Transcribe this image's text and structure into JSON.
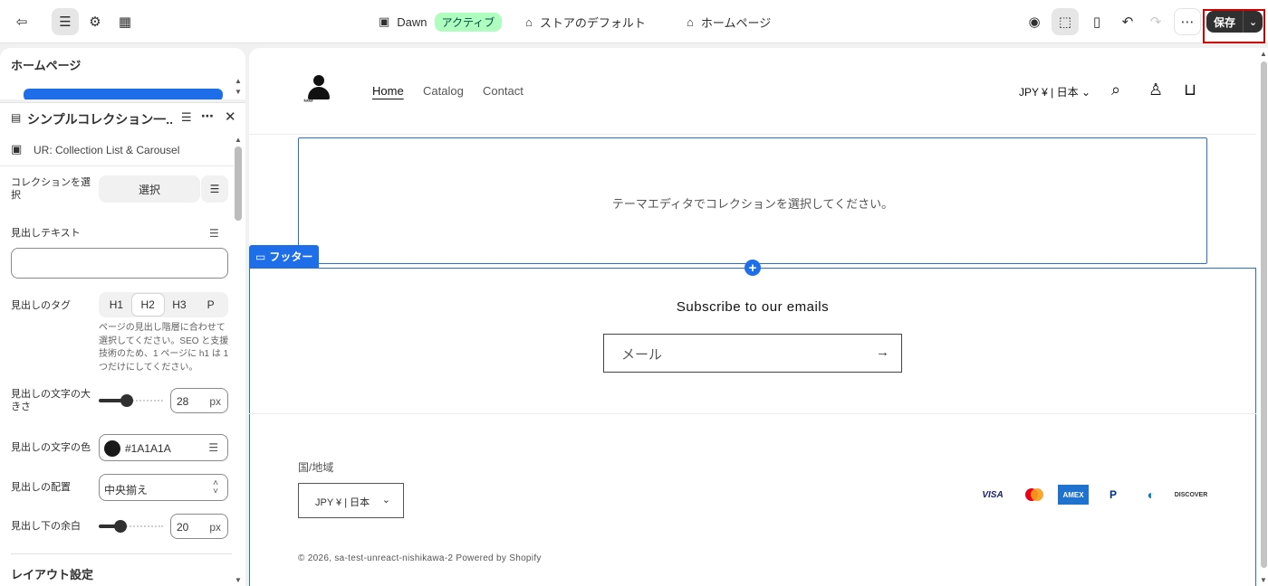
{
  "topbar": {
    "theme_name": "Dawn",
    "theme_status": "アクティブ",
    "store_default": "ストアのデフォルト",
    "page_template": "ホームページ",
    "save_label": "保存"
  },
  "sidebar": {
    "page_title": "ホームページ",
    "section_title": "シンプルコレクション一...",
    "app_block": "UR: Collection List & Carousel",
    "fields": {
      "collection_label": "コレクションを選択",
      "select_button": "選択",
      "heading_text_label": "見出しテキスト",
      "heading_text_value": "",
      "heading_tag_label": "見出しのタグ",
      "heading_tags": [
        "H1",
        "H2",
        "H3",
        "P"
      ],
      "heading_tag_selected": "H2",
      "heading_tag_help": "ページの見出し階層に合わせて選択してください。SEO と支援技術のため、1 ページに h1 は 1 つだけにしてください。",
      "font_size_label": "見出しの文字の大きさ",
      "font_size_value": "28",
      "font_size_unit": "px",
      "font_size_fraction": 0.42,
      "color_label": "見出しの文字の色",
      "color_value": "#1A1A1A",
      "align_label": "見出しの配置",
      "align_value": "中央揃え",
      "margin_label": "見出し下の余白",
      "margin_value": "20",
      "margin_unit": "px",
      "margin_fraction": 0.33
    },
    "next_section": "レイアウト設定"
  },
  "preview": {
    "logo_stars": "****",
    "nav": [
      "Home",
      "Catalog",
      "Contact"
    ],
    "currency": "JPY ¥ | 日本",
    "collection_placeholder": "テーマエディタでコレクションを選択してください。",
    "footer_tag": "フッター",
    "subscribe_title": "Subscribe to our emails",
    "email_placeholder": "メール",
    "country_label": "国/地域",
    "country_value": "JPY ¥ | 日本",
    "payments": [
      "VISA",
      "Mastercard",
      "AMEX",
      "PayPal",
      "Diners",
      "DISCOVER"
    ],
    "copyright": "© 2026, sa-test-unreact-nishikawa-2 Powered by Shopify"
  },
  "colors": {
    "accent": "#1e6eea",
    "save_bg": "#303030",
    "active_badge_bg": "#affebf",
    "highlight_border": "#d10000"
  }
}
